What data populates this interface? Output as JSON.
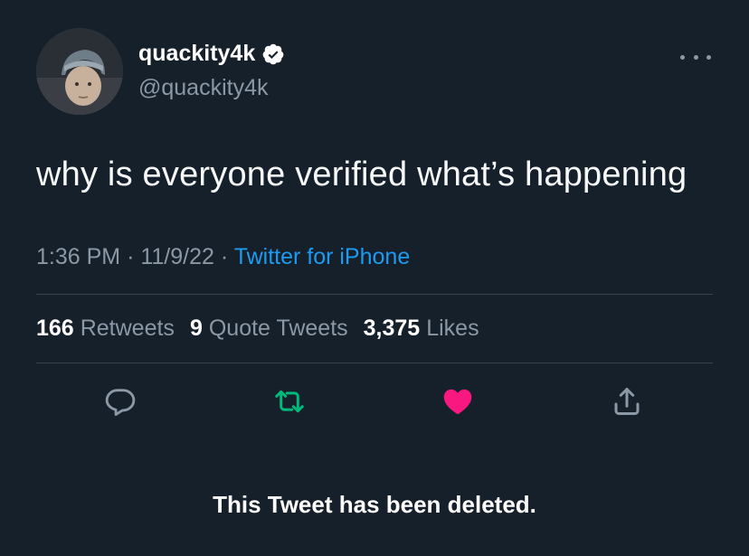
{
  "author": {
    "display_name": "quackity4k",
    "handle": "@quackity4k",
    "verified": true
  },
  "tweet": {
    "text": "why is everyone verified what’s happening",
    "time": "1:36 PM",
    "date": "11/9/22",
    "separator": "·",
    "source": "Twitter for iPhone"
  },
  "stats": {
    "retweets_count": "166",
    "retweets_label": "Retweets",
    "quotes_count": "9",
    "quotes_label": "Quote Tweets",
    "likes_count": "3,375",
    "likes_label": "Likes"
  },
  "actions": {
    "reply_icon": "reply-icon",
    "retweet_icon": "retweet-icon",
    "like_icon": "like-icon",
    "share_icon": "share-icon"
  },
  "colors": {
    "background": "#15202b",
    "muted_text": "#8b98a5",
    "link": "#1d9bf0",
    "retweet_green": "#00ba7c",
    "like_pink": "#f91880",
    "verified_badge": "#ffffff"
  },
  "notice": "This Tweet has been deleted."
}
